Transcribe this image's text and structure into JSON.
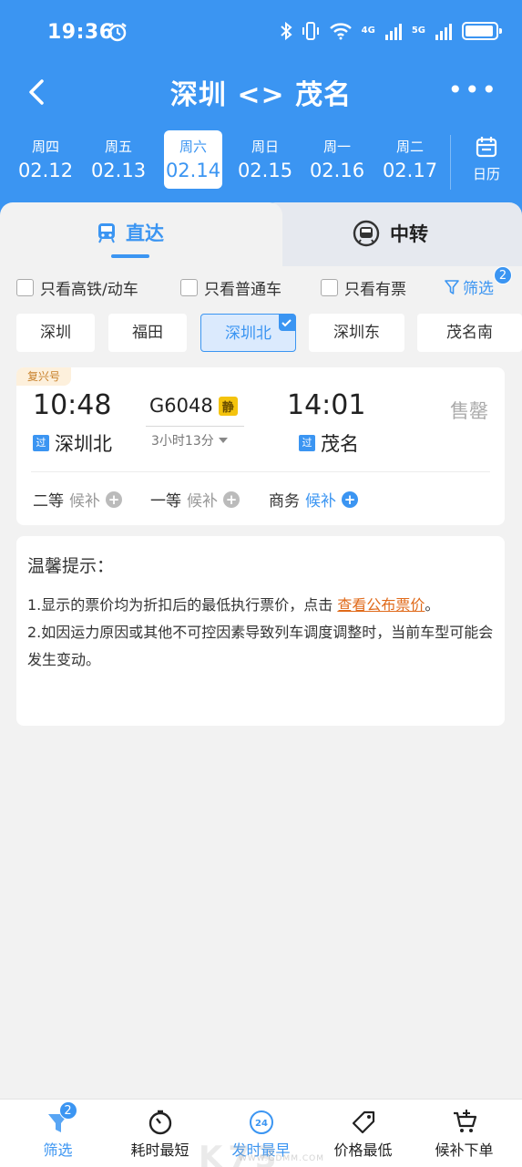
{
  "status_bar": {
    "time": "19:36",
    "network1": "4G",
    "network2": "5G"
  },
  "header": {
    "title": "深圳 <> 茂名"
  },
  "dates": [
    {
      "weekday": "周四",
      "date": "02.12"
    },
    {
      "weekday": "周五",
      "date": "02.13"
    },
    {
      "weekday": "周六",
      "date": "02.14",
      "selected": true
    },
    {
      "weekday": "周日",
      "date": "02.15"
    },
    {
      "weekday": "周一",
      "date": "02.16"
    },
    {
      "weekday": "周二",
      "date": "02.17"
    }
  ],
  "calendar_label": "日历",
  "tabs": {
    "direct": "直达",
    "transfer": "中转"
  },
  "filters": {
    "high_speed": "只看高铁/动车",
    "normal": "只看普通车",
    "available": "只看有票",
    "filter_label": "筛选",
    "filter_count": "2"
  },
  "stations": [
    {
      "name": "深圳"
    },
    {
      "name": "福田"
    },
    {
      "name": "深圳北",
      "selected": true
    },
    {
      "name": "深圳东"
    },
    {
      "name": "茂名南"
    }
  ],
  "train": {
    "tag": "复兴号",
    "depart_time": "10:48",
    "train_no": "G6048",
    "quiet_tag": "静",
    "duration": "3小时13分",
    "arrive_time": "14:01",
    "status": "售罄",
    "pass_tag": "过",
    "from_station": "深圳北",
    "to_station": "茂名",
    "seats": [
      {
        "class": "二等",
        "status": "候补",
        "highlight": false
      },
      {
        "class": "一等",
        "status": "候补",
        "highlight": false
      },
      {
        "class": "商务",
        "status": "候补",
        "highlight": true
      }
    ]
  },
  "tips": {
    "title": "温馨提示：",
    "line1_pre": "1.显示的票价均为折扣后的最低执行票价，点击 ",
    "line1_link": "查看公布票价",
    "line1_post": "。",
    "line2": "2.如因运力原因或其他不可控因素导致列车调度调整时，当前车型可能会发生变动。"
  },
  "bottom_nav": {
    "filter": "筛选",
    "filter_count": "2",
    "shortest": "耗时最短",
    "earliest": "发时最早",
    "earliest_icon_text": "24",
    "cheapest": "价格最低",
    "waitlist": "候补下单"
  },
  "watermark": {
    "main": "K73",
    "sub": "WWW.GDMM.COM"
  },
  "colors": {
    "accent": "#3b95f2",
    "link": "#e06a1a",
    "quiet": "#f4c30d"
  }
}
